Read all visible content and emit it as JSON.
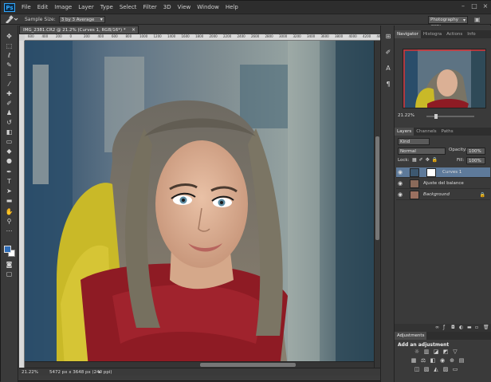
{
  "app": {
    "logo": "Ps"
  },
  "menu": [
    "File",
    "Edit",
    "Image",
    "Layer",
    "Type",
    "Select",
    "Filter",
    "3D",
    "View",
    "Window",
    "Help"
  ],
  "options": {
    "sample_size_label": "Sample Size:",
    "sample_size_value": "3 by 3 Average",
    "workspace": "Photography (MO)"
  },
  "document": {
    "tab_title": "IMG_2381.CR2 @ 21.2% (Curves 1, RGB/16*) *",
    "ruler_ticks": [
      "600",
      "400",
      "200",
      "0",
      "200",
      "400",
      "600",
      "800",
      "1000",
      "1200",
      "1400",
      "1600",
      "1800",
      "2000",
      "2200",
      "2400",
      "2600",
      "2800",
      "3000",
      "3200",
      "3400",
      "3600",
      "3800",
      "4000",
      "4200",
      "4400"
    ]
  },
  "status": {
    "zoom": "21.22%",
    "info": "5472 px x 3648 px (240 ppi)"
  },
  "navigator": {
    "tabs": [
      "Navigator",
      "Histogra",
      "Actions",
      "Info"
    ],
    "zoom": "21.22%"
  },
  "layers": {
    "tabs": [
      "Layers",
      "Channels",
      "Paths"
    ],
    "kind": "Kind",
    "blend": "Normal",
    "opacity_label": "Opacity:",
    "opacity": "100%",
    "lock_label": "Lock:",
    "fill_label": "Fill:",
    "fill": "100%",
    "items": [
      {
        "name": "Curves 1",
        "selected": true
      },
      {
        "name": "Ajuste del balance",
        "selected": false
      },
      {
        "name": "Background",
        "selected": false
      }
    ]
  },
  "adjustments": {
    "tab": "Adjustments",
    "title": "Add an adjustment"
  },
  "colors": {
    "foreground": "#2f6db8",
    "background": "#ffffff",
    "selection": "#5e7a9a"
  }
}
